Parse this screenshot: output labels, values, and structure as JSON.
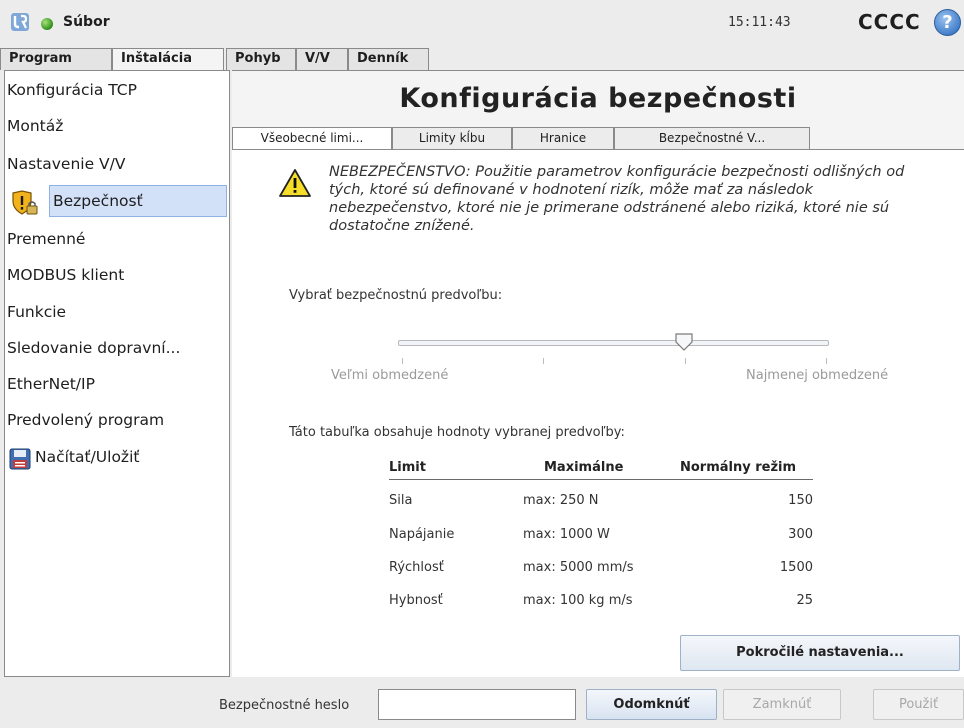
{
  "titlebar": {
    "logo_icon": "ur-logo-icon",
    "status_color": "#2f8f1a",
    "file_menu_label": "Súbor",
    "clock": "15:11:43",
    "robot_name": "CCCC",
    "help_symbol": "?"
  },
  "main_tabs": [
    {
      "label": "Program",
      "active": false
    },
    {
      "label": "Inštalácia",
      "active": true
    },
    {
      "label": "Pohyb",
      "active": false
    },
    {
      "label": "V/V",
      "active": false
    },
    {
      "label": "Denník",
      "active": false
    }
  ],
  "sidebar": {
    "items": [
      {
        "label": "Konfigurácia TCP"
      },
      {
        "label": "Montáž"
      },
      {
        "label": "Nastavenie V/V"
      },
      {
        "label": "Bezpečnosť",
        "icon": "shield-lock-icon",
        "selected": true
      },
      {
        "label": "Premenné"
      },
      {
        "label": "MODBUS klient"
      },
      {
        "label": "Funkcie"
      },
      {
        "label": "Sledovanie dopravní..."
      },
      {
        "label": "EtherNet/IP"
      },
      {
        "label": "Predvolený program"
      },
      {
        "label": "Načítať/Uložiť",
        "icon": "floppy-disk-icon"
      }
    ]
  },
  "main": {
    "title": "Konfigurácia bezpečnosti",
    "sub_tabs": [
      {
        "label": "Všeobecné limi...",
        "active": true
      },
      {
        "label": "Limity kĺbu",
        "active": false
      },
      {
        "label": "Hranice",
        "active": false
      },
      {
        "label": "Bezpečnostné V...",
        "active": false
      }
    ],
    "warning_icon": "warning-triangle-icon",
    "warning_text": "NEBEZPEČENSTVO: Použitie parametrov konfigurácie bezpečnosti odlišných od tých, ktoré sú definované v hodnotení rizík, môže mať za následok nebezpečenstvo, ktoré nie je primerane odstránené alebo riziká, ktoré nie sú dostatočne znížené.",
    "preset_label": "Vybrať bezpečnostnú predvoľbu:",
    "slider": {
      "min_label": "Veľmi obmedzené",
      "max_label": "Najmenej obmedzené",
      "position": 0.667,
      "steps": 4
    },
    "table_caption": "Táto tabuľka obsahuje hodnoty vybranej predvoľby:",
    "table": {
      "headers": [
        "Limit",
        "Maximálne",
        "Normálny režim"
      ],
      "rows": [
        {
          "limit": "Sila",
          "max": "max: 250 N",
          "normal": "150"
        },
        {
          "limit": "Napájanie",
          "max": "max: 1000 W",
          "normal": "300"
        },
        {
          "limit": "Rýchlosť",
          "max": "max: 5000 mm/s",
          "normal": "1500"
        },
        {
          "limit": "Hybnosť",
          "max": "max: 100 kg m/s",
          "normal": "25"
        }
      ]
    },
    "advanced_button": "Pokročilé nastavenia..."
  },
  "bottom_bar": {
    "password_label": "Bezpečnostné heslo",
    "password_value": "",
    "unlock_button": "Odomknúť",
    "lock_button": "Zamknúť",
    "apply_button": "Použiť"
  }
}
